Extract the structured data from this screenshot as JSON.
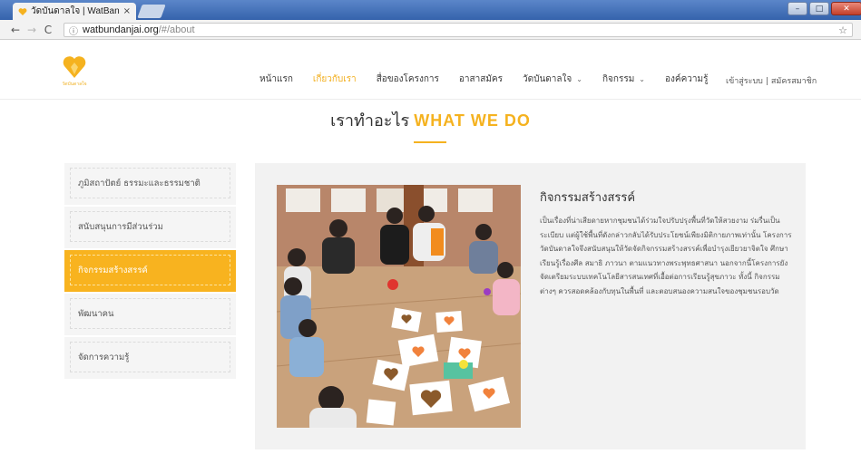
{
  "browser": {
    "tab_title": "วัดบันดาลใจ | WatBandanj",
    "tab_close": "×",
    "url_host": "watbundanjai.org",
    "url_path": "/#/about",
    "info_icon": "info-icon",
    "star_icon": "star-icon",
    "window_controls": [
      "–",
      "□",
      "✕"
    ]
  },
  "site": {
    "logo_text": "วัดบันดาลใจ",
    "nav": [
      {
        "label": "หน้าแรก"
      },
      {
        "label": "เกี่ยวกับเรา"
      },
      {
        "label": "สื่อของโครงการ"
      },
      {
        "label": "อาสาสมัคร"
      },
      {
        "label": "วัดบันดาลใจ"
      },
      {
        "label": "กิจกรรม"
      },
      {
        "label": "องค์ความรู้"
      }
    ],
    "login": "เข้าสู่ระบบ",
    "separator": "|",
    "register": "สมัครสมาชิก"
  },
  "heading": {
    "thai": "เราทำอะไร",
    "english": "WHAT WE DO"
  },
  "sidebar": {
    "items": [
      {
        "label": "ภูมิสถาปัตย์ ธรรมะและธรรมชาติ"
      },
      {
        "label": "สนับสนุนการมีส่วนร่วม"
      },
      {
        "label": "กิจกรรมสร้างสรรค์"
      },
      {
        "label": "พัฒนาคน"
      },
      {
        "label": "จัดการความรู้"
      }
    ],
    "active_index": 2
  },
  "content": {
    "title": "กิจกรรมสร้างสรรค์",
    "body": "เป็นเรื่องที่น่าเสียดายหากชุมชนได้ร่วมใจปรับปรุงพื้นที่วัดให้สวยงาม ร่มรื่นเป็นระเบียบ แต่ผู้ใช้พื้นที่ดังกล่าวกลับได้รับประโยชน์เพียงมิติกายภาพเท่านั้น โครงการวัดบันดาลใจจึงสนับสนุนให้วัดจัดกิจกรรมสร้างสรรค์เพื่อบำรุงเยียวยาจิตใจ ศึกษาเรียนรู้เรื่องศีล สมาธิ ภาวนา ตามแนวทางพระพุทธศาสนา นอกจากนี้โครงการยังจัดเตรียมระบบเทคโนโลยีสารสนเทศที่เอื้อต่อการเรียนรู้สุขภาวะ ทั้งนี้ กิจกรรมต่างๆ ควรสอดคล้องกับทุนในพื้นที่ และตอบสนองความสนใจของชุมชนรอบวัด",
    "photo_desc": "children-crafting-photo"
  },
  "colors": {
    "accent": "#f5b21f",
    "sidebar_bg": "#f5f5f5",
    "card_bg": "#f2f2f2"
  }
}
